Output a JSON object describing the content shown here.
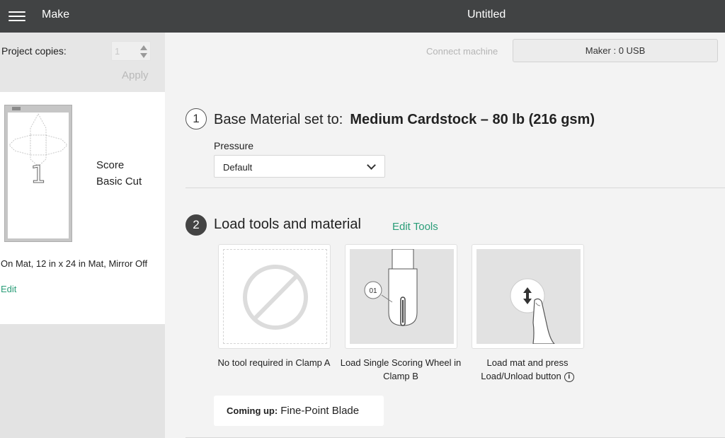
{
  "header": {
    "app_title": "Make",
    "doc_title": "Untitled"
  },
  "project": {
    "copies_label": "Project copies:",
    "copies_value": "1",
    "apply_label": "Apply"
  },
  "mat": {
    "number": "1",
    "operations": [
      "Score",
      "Basic Cut"
    ],
    "info": "On Mat, 12 in x 24 in Mat, Mirror Off",
    "edit_label": "Edit"
  },
  "machine": {
    "connect_label": "Connect machine",
    "button_label": "Maker : 0 USB"
  },
  "step1": {
    "number": "1",
    "title": "Base Material set to:",
    "material": "Medium Cardstock – 80 lb (216 gsm)",
    "pressure_label": "Pressure",
    "pressure_value": "Default"
  },
  "step2": {
    "number": "2",
    "title": "Load tools and material",
    "edit_tools_label": "Edit Tools"
  },
  "cards": [
    {
      "label": "No tool required in Clamp A",
      "icon": "no-tool-icon"
    },
    {
      "label": "Load Single Scoring Wheel in Clamp B",
      "icon": "scoring-wheel-icon",
      "badge": "01"
    },
    {
      "label": "Load mat and press Load/Unload button",
      "icon": "load-button-icon",
      "info_icon": "i"
    }
  ],
  "coming_up": {
    "label": "Coming up:",
    "value": "Fine-Point Blade"
  }
}
